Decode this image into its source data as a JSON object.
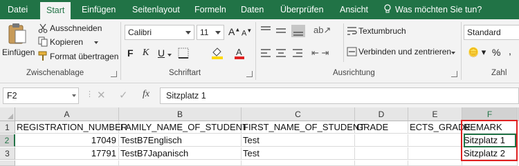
{
  "ribbon_tabs": [
    "Datei",
    "Start",
    "Einfügen",
    "Seitenlayout",
    "Formeln",
    "Daten",
    "Überprüfen",
    "Ansicht"
  ],
  "tell_me": "Was möchten Sie tun?",
  "clipboard": {
    "paste": "Einfügen",
    "cut": "Ausschneiden",
    "copy": "Kopieren",
    "format_painter": "Format übertragen",
    "group_label": "Zwischenablage"
  },
  "font": {
    "name": "Calibri",
    "size": "11",
    "group_label": "Schriftart"
  },
  "alignment": {
    "wrap_text": "Textumbruch",
    "merge_center": "Verbinden und zentrieren",
    "group_label": "Ausrichtung"
  },
  "number": {
    "format": "Standard",
    "group_label": "Zahl"
  },
  "formula_bar": {
    "name_box": "F2",
    "fx": "fx",
    "value": "Sitzplatz 1"
  },
  "sheet": {
    "columns": [
      "A",
      "B",
      "C",
      "D",
      "E",
      "F"
    ],
    "row_numbers": [
      "1",
      "2",
      "3"
    ],
    "rows": [
      [
        "REGISTRATION_NUMBER",
        "FAMILY_NAME_OF_STUDENT",
        "FIRST_NAME_OF_STUDENT",
        "GRADE",
        "ECTS_GRADE",
        "REMARK"
      ],
      [
        "17049",
        "TestB7Englisch",
        "Test",
        "",
        "",
        "Sitzplatz 1"
      ],
      [
        "17791",
        "TestB7Japanisch",
        "Test",
        "",
        "",
        "Sitzplatz 2"
      ]
    ]
  },
  "colors": {
    "accent": "#217346",
    "highlight_box": "#e02020"
  }
}
